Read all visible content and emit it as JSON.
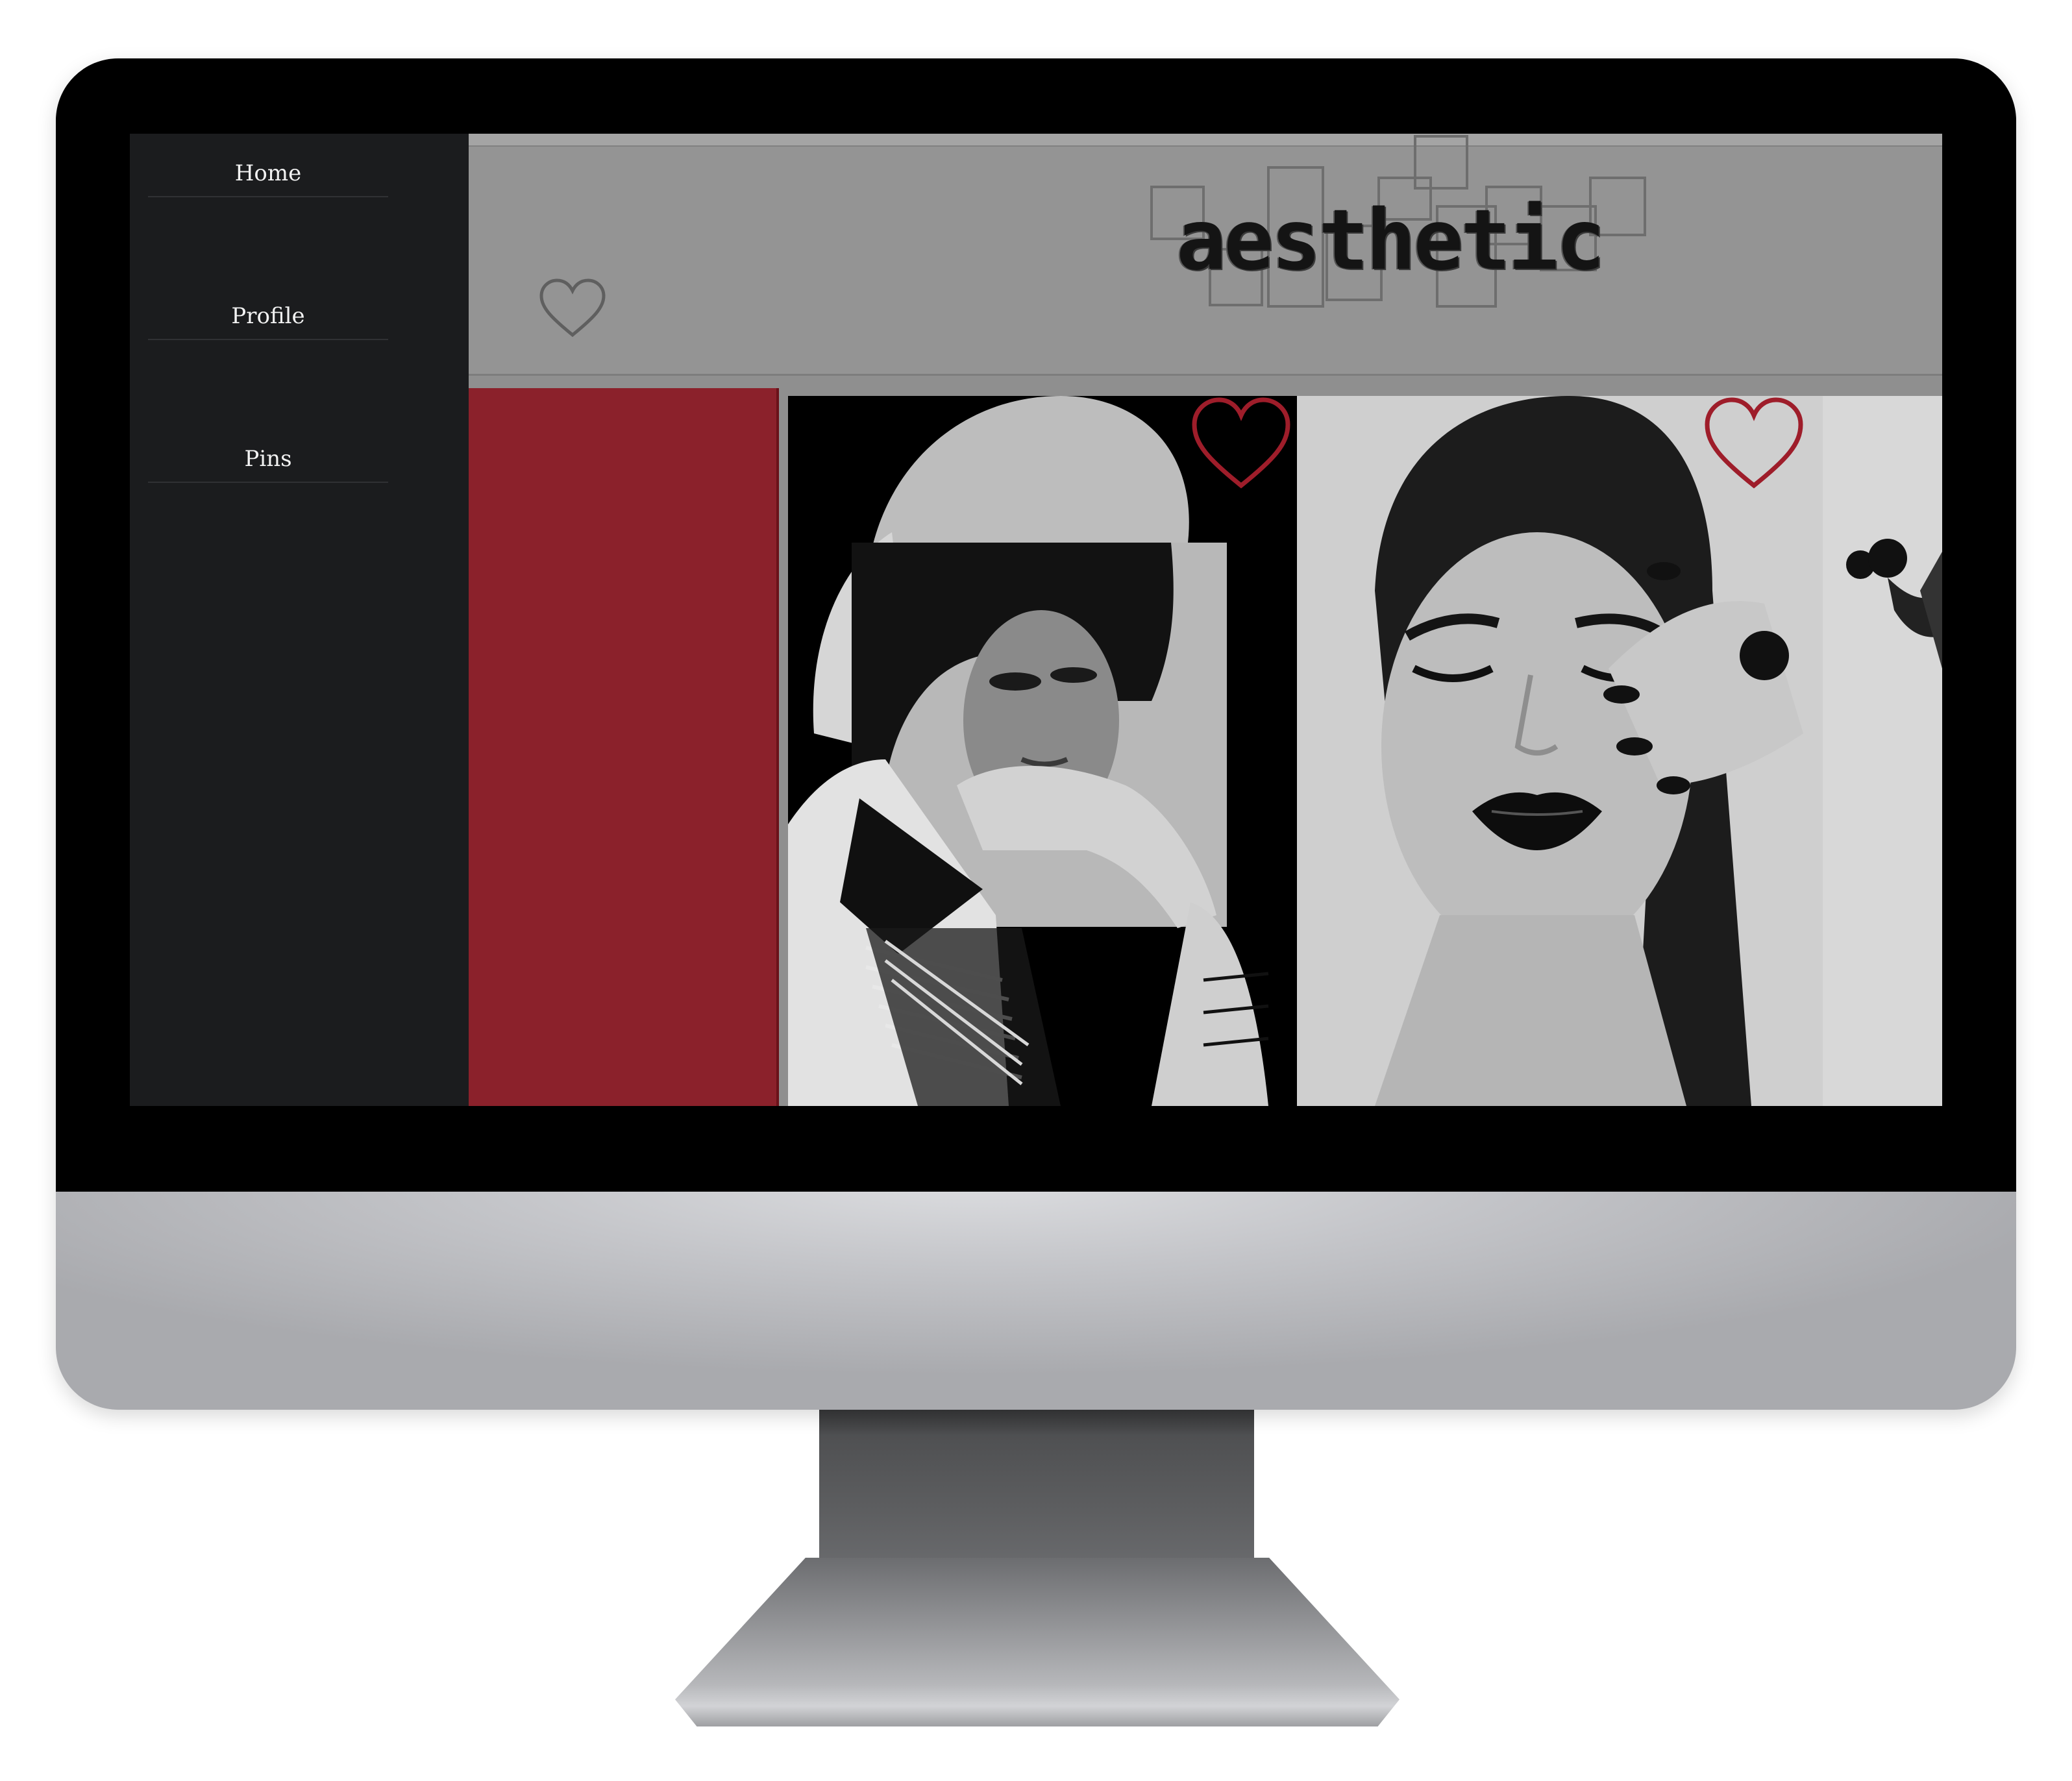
{
  "nav": {
    "items": [
      {
        "label": "Home"
      },
      {
        "label": "Profile"
      },
      {
        "label": "Pins"
      }
    ]
  },
  "header": {
    "logo_text": "aesthetic",
    "heart_icon": "heart-outline-icon"
  },
  "pins": [
    {
      "kind": "color-block",
      "color": "#8b212b"
    },
    {
      "kind": "photo",
      "subject": "bob-haircut-portrait",
      "liked": true
    },
    {
      "kind": "photo",
      "subject": "black-lipstick-portrait",
      "liked": true
    },
    {
      "kind": "photo",
      "subject": "partial-image"
    }
  ],
  "colors": {
    "sidebar": "#1b1c1e",
    "header": "#949494",
    "accent_red": "#8b212b",
    "heart_red": "#9e1d2a",
    "bezel": "#000000"
  }
}
